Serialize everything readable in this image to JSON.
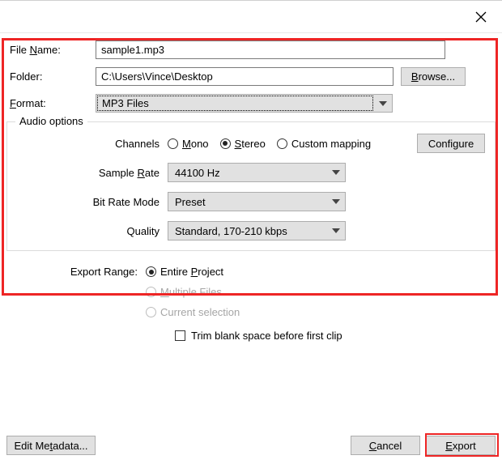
{
  "labels": {
    "filename_label_pre": "File ",
    "filename_label_ul": "N",
    "filename_label_post": "ame:",
    "folder_label": "Folder:",
    "format_label_ul": "F",
    "format_label_post": "ormat:",
    "audio_options": "Audio options",
    "channels": "Channels",
    "mono_ul": "M",
    "mono_post": "ono",
    "stereo_ul": "S",
    "stereo_post": "tereo",
    "custom_mapping": "Custom mapping",
    "configure": "Configure",
    "sample_rate_pre": "Sample ",
    "sample_rate_ul": "R",
    "sample_rate_post": "ate",
    "bit_rate_mode": "Bit Rate Mode",
    "quality": "Quality",
    "export_range": "Export Range:",
    "entire_project_pre": "Entire ",
    "entire_project_ul": "P",
    "entire_project_post": "roject",
    "multiple_files_ul": "M",
    "multiple_files_post": "ultiple Files",
    "current_selection": "Current selection",
    "trim_blank": "Trim blank space before first clip",
    "edit_metadata_pre": "Edit Me",
    "edit_metadata_ul": "t",
    "edit_metadata_post": "adata...",
    "cancel_ul": "C",
    "cancel_post": "ancel",
    "export_ul": "E",
    "export_post": "xport",
    "browse_ul": "B",
    "browse_post": "rowse..."
  },
  "values": {
    "filename": "sample1.mp3",
    "folder": "C:\\Users\\Vince\\Desktop",
    "format": "MP3 Files",
    "sample_rate": "44100 Hz",
    "bit_rate_mode": "Preset",
    "quality": "Standard, 170-210 kbps"
  }
}
